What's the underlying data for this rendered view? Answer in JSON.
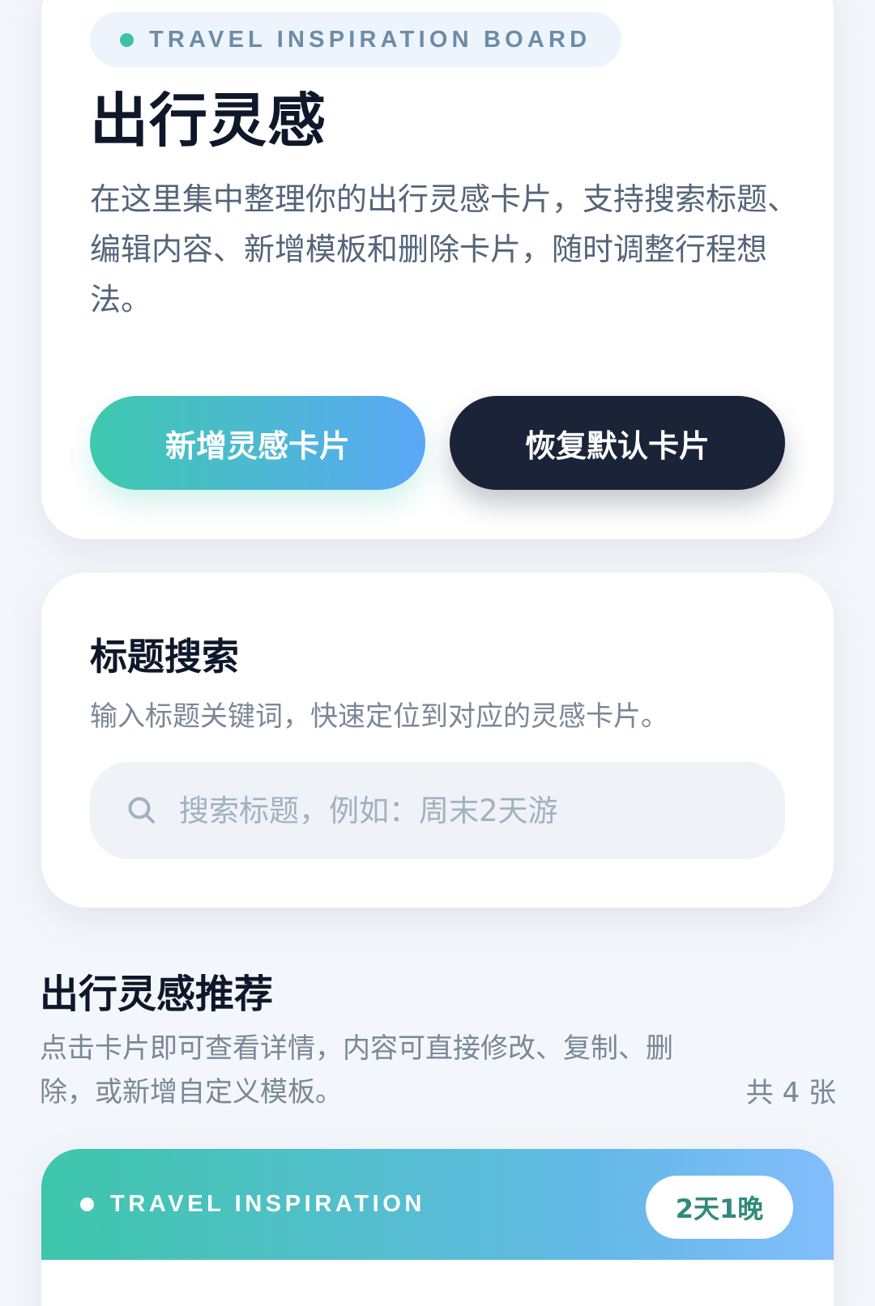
{
  "hero": {
    "tag": "TRAVEL INSPIRATION BOARD",
    "title": "出行灵感",
    "description": "在这里集中整理你的出行灵感卡片，支持搜索标题、编辑内容、新增模板和删除卡片，随时调整行程想法。",
    "add_button": "新增灵感卡片",
    "reset_button": "恢复默认卡片",
    "accent_color": "#3ec9ad",
    "dark_color": "#1b2338"
  },
  "search": {
    "title": "标题搜索",
    "description": "输入标题关键词，快速定位到对应的灵感卡片。",
    "placeholder": "搜索标题，例如：周末2天游",
    "value": "",
    "icon": "search-icon"
  },
  "recommend": {
    "title": "出行灵感推荐",
    "description": "点击卡片即可查看详情，内容可直接修改、复制、删除，或新增自定义模板。",
    "count": "共 4 张"
  },
  "cards": [
    {
      "tag": "TRAVEL INSPIRATION",
      "duration": "2天1晚"
    }
  ]
}
